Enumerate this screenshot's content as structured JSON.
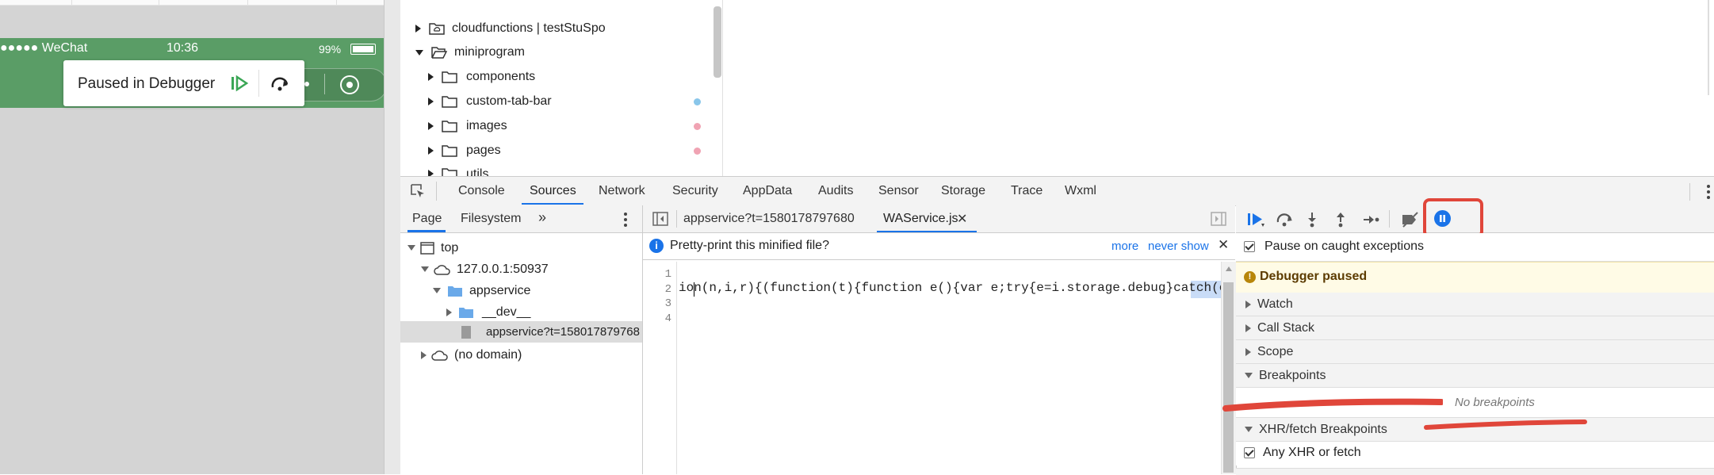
{
  "simulator": {
    "carrier": "●●●●● WeChat",
    "time": "10:36",
    "battery": "99%",
    "paused_label": "Paused in Debugger"
  },
  "file_tree": {
    "items": [
      {
        "label": "cloudfunctions | testStuSpo",
        "expanded": false
      },
      {
        "label": "miniprogram",
        "expanded": true
      },
      {
        "label": "components",
        "expanded": false
      },
      {
        "label": "custom-tab-bar",
        "expanded": false,
        "dot": "#89c6ea"
      },
      {
        "label": "images",
        "expanded": false,
        "dot": "#f0a3b3"
      },
      {
        "label": "pages",
        "expanded": false,
        "dot": "#f0a3b3"
      },
      {
        "label": "utils",
        "expanded": false
      }
    ]
  },
  "devtools_tabs": [
    "Console",
    "Sources",
    "Network",
    "Security",
    "AppData",
    "Audits",
    "Sensor",
    "Storage",
    "Trace",
    "Wxml"
  ],
  "active_tab": "Sources",
  "navigator": {
    "tabs": [
      "Page",
      "Filesystem"
    ],
    "more": "»",
    "tree": [
      {
        "label": "top"
      },
      {
        "label": "127.0.0.1:50937"
      },
      {
        "label": "appservice"
      },
      {
        "label": "__dev__"
      },
      {
        "label": "appservice?t=158017879768"
      },
      {
        "label": "(no domain)"
      }
    ]
  },
  "editor": {
    "tabs": [
      {
        "label": "appservice?t=1580178797680"
      },
      {
        "label": "WAService.js"
      }
    ],
    "pretty_print": {
      "message": "Pretty-print this minified file?",
      "more": "more",
      "never_show": "never show"
    },
    "line_numbers": [
      "1",
      "2",
      "3",
      "4"
    ],
    "code_line_2": "ion(n,i,r){(function(t){function e(){var e;try{e=i.storage.debug}catch(e){}re"
  },
  "debugger": {
    "pause_on_caught": "Pause on caught exceptions",
    "paused_banner": "Debugger paused",
    "sections": {
      "watch": "Watch",
      "call_stack": "Call Stack",
      "scope": "Scope",
      "breakpoints": "Breakpoints",
      "no_breakpoints": "No breakpoints",
      "xhr": "XHR/fetch Breakpoints",
      "any_xhr": "Any XHR or fetch"
    }
  },
  "colors": {
    "status_green": "#5a9d66",
    "accent_blue": "#1a73e8",
    "annotation_red": "#e0463a",
    "paused_banner_bg": "#fffbe6"
  }
}
